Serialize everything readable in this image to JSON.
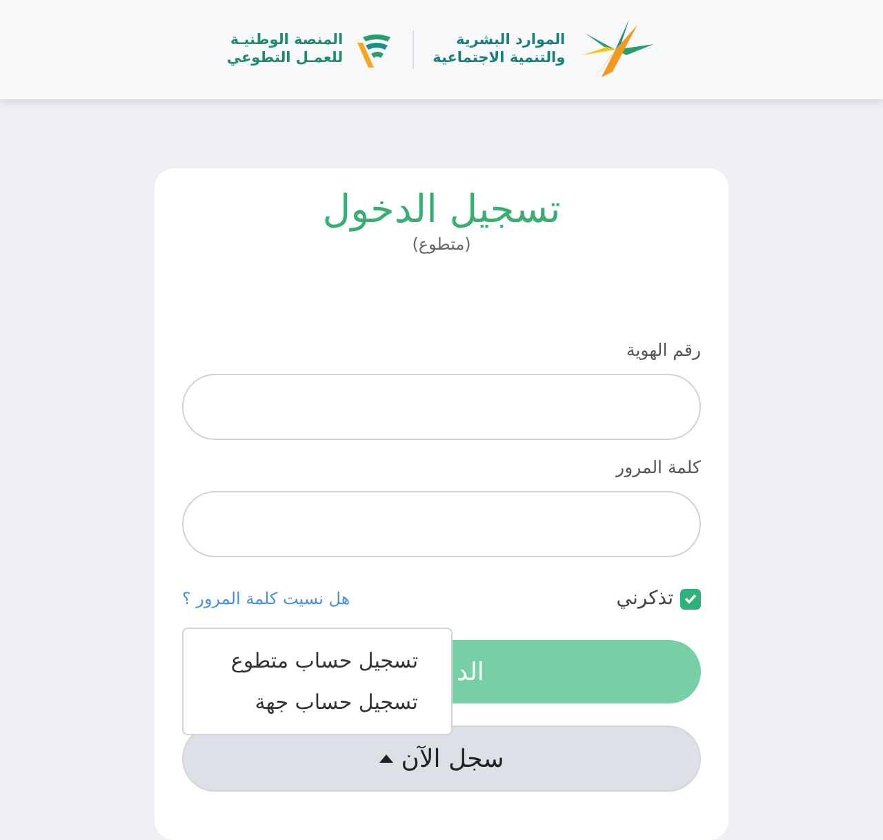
{
  "header": {
    "logos": [
      {
        "kind": "ministry",
        "lines": [
          "الموارد البشرية",
          "والتنمية الاجتماعية"
        ]
      },
      {
        "kind": "platform",
        "lines": [
          "المنصة الوطنيـة",
          "للعمـل التطوعي"
        ]
      }
    ]
  },
  "login": {
    "title": "تسجيل الدخول",
    "subtitle": "(متطوع)",
    "fields": [
      {
        "label": "رقم الهوية"
      },
      {
        "label": "كلمة المرور"
      }
    ],
    "remember": {
      "label": "تذكرني",
      "checked": true
    },
    "forgot_link": "هل نسيت كلمة المرور ؟",
    "login_button": "الد",
    "register_button": {
      "label": "سجل الآن",
      "expanded": true
    },
    "register_menu": [
      "تسجيل حساب متطوع",
      "تسجيل حساب جهة"
    ]
  }
}
